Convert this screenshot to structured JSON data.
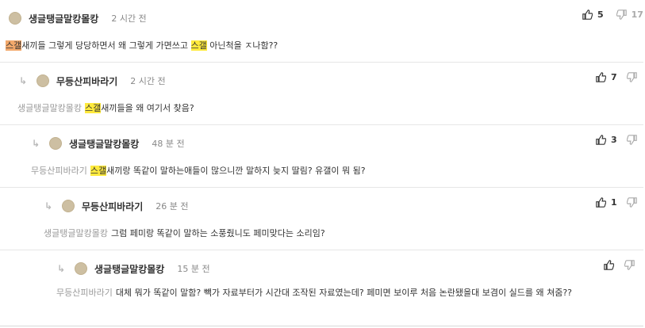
{
  "comments": [
    {
      "author": "생글탱글말캉몰캉",
      "time": "2 시간 전",
      "body": {
        "hl1": "스갤",
        "t1": "새끼들 그렇게 당당하면서 왜 그렇게 가면쓰고 ",
        "hl2": "스갤",
        "t2": " 아닌척을 ㅈ나함??"
      },
      "upvotes": "5",
      "downvotes": "17"
    },
    {
      "author": "무등산피바라기",
      "time": "2 시간 전",
      "mention": "생글탱글말캉몰캉",
      "body": {
        "hl1": "스갤",
        "t1": "새끼들을 왜 여기서 찾음?"
      },
      "upvotes": "7",
      "downvotes": ""
    },
    {
      "author": "생글탱글말캉몰캉",
      "time": "48 분 전",
      "mention": "무등산피바라기",
      "body": {
        "hl1": "스갤",
        "t1": "새끼랑 똑같이 말하는애들이 많으니깐 말하지 늦지 딸림? 유갤이 뭐 됨?"
      },
      "upvotes": "3",
      "downvotes": ""
    },
    {
      "author": "무등산피바라기",
      "time": "26 분 전",
      "mention": "생글탱글말캉몰캉",
      "body": {
        "t1": "그럼 페미랑 똑같이 말하는 소풍줬니도 페미맞다는 소리임?"
      },
      "upvotes": "1",
      "downvotes": ""
    },
    {
      "author": "생글탱글말캉몰캉",
      "time": "15 분 전",
      "mention": "무등산피바라기",
      "body": {
        "t1": "대체 뭐가 똑같이 말함? 빽가 자료부터가 시간대 조작된 자료였는데? 페미면 보이루 처음 논란됐을대 보겸이 실드를 왜 쳐줌??"
      },
      "upvotes": "",
      "downvotes": ""
    }
  ]
}
